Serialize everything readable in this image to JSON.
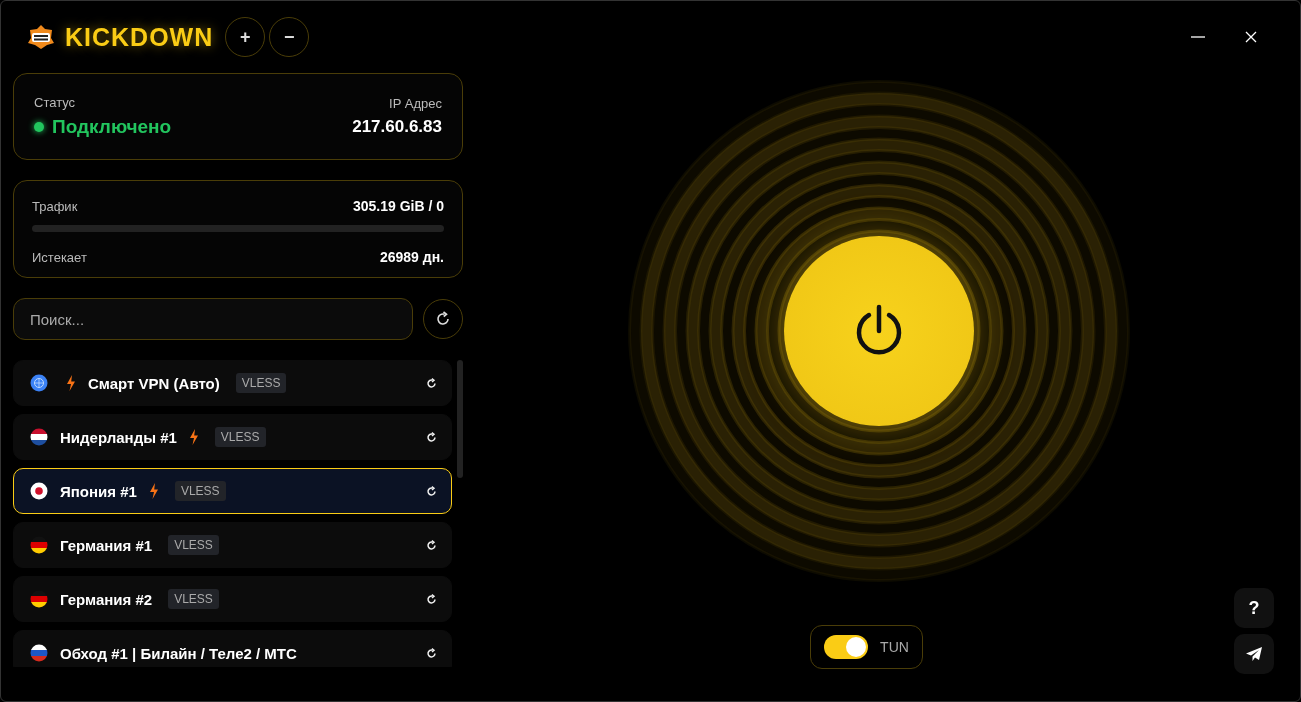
{
  "app": {
    "title": "KICKDOWN",
    "zoom_in": "+",
    "zoom_out": "−"
  },
  "status": {
    "label": "Статус",
    "value": "Подключено",
    "connected": true,
    "ip_label": "IP Адрес",
    "ip": "217.60.6.83"
  },
  "traffic": {
    "label": "Трафик",
    "value": "305.19 GiB / 0",
    "level": 0,
    "expires_label": "Истекает",
    "expires": "26989 дн."
  },
  "search": {
    "placeholder": "Поиск..."
  },
  "servers": [
    {
      "kind": "globe",
      "name": "Смарт VPN (Авто)",
      "fast": true,
      "protocol": "VLESS",
      "selected": false
    },
    {
      "kind": "nl",
      "name": "Нидерланды #1",
      "fast": true,
      "protocol": "VLESS",
      "selected": false
    },
    {
      "kind": "jp",
      "name": "Япония #1",
      "fast": true,
      "protocol": "VLESS",
      "selected": true
    },
    {
      "kind": "de",
      "name": "Германия #1",
      "fast": false,
      "protocol": "VLESS",
      "selected": false
    },
    {
      "kind": "de",
      "name": "Германия #2",
      "fast": false,
      "protocol": "VLESS",
      "selected": false
    },
    {
      "kind": "ru",
      "name": "Обход #1 | Билайн / Теле2 / МТС",
      "fast": false,
      "selected": false
    }
  ],
  "power": {
    "on": true
  },
  "tun": {
    "label": "TUN",
    "on": true
  },
  "help": {
    "label": "?"
  }
}
